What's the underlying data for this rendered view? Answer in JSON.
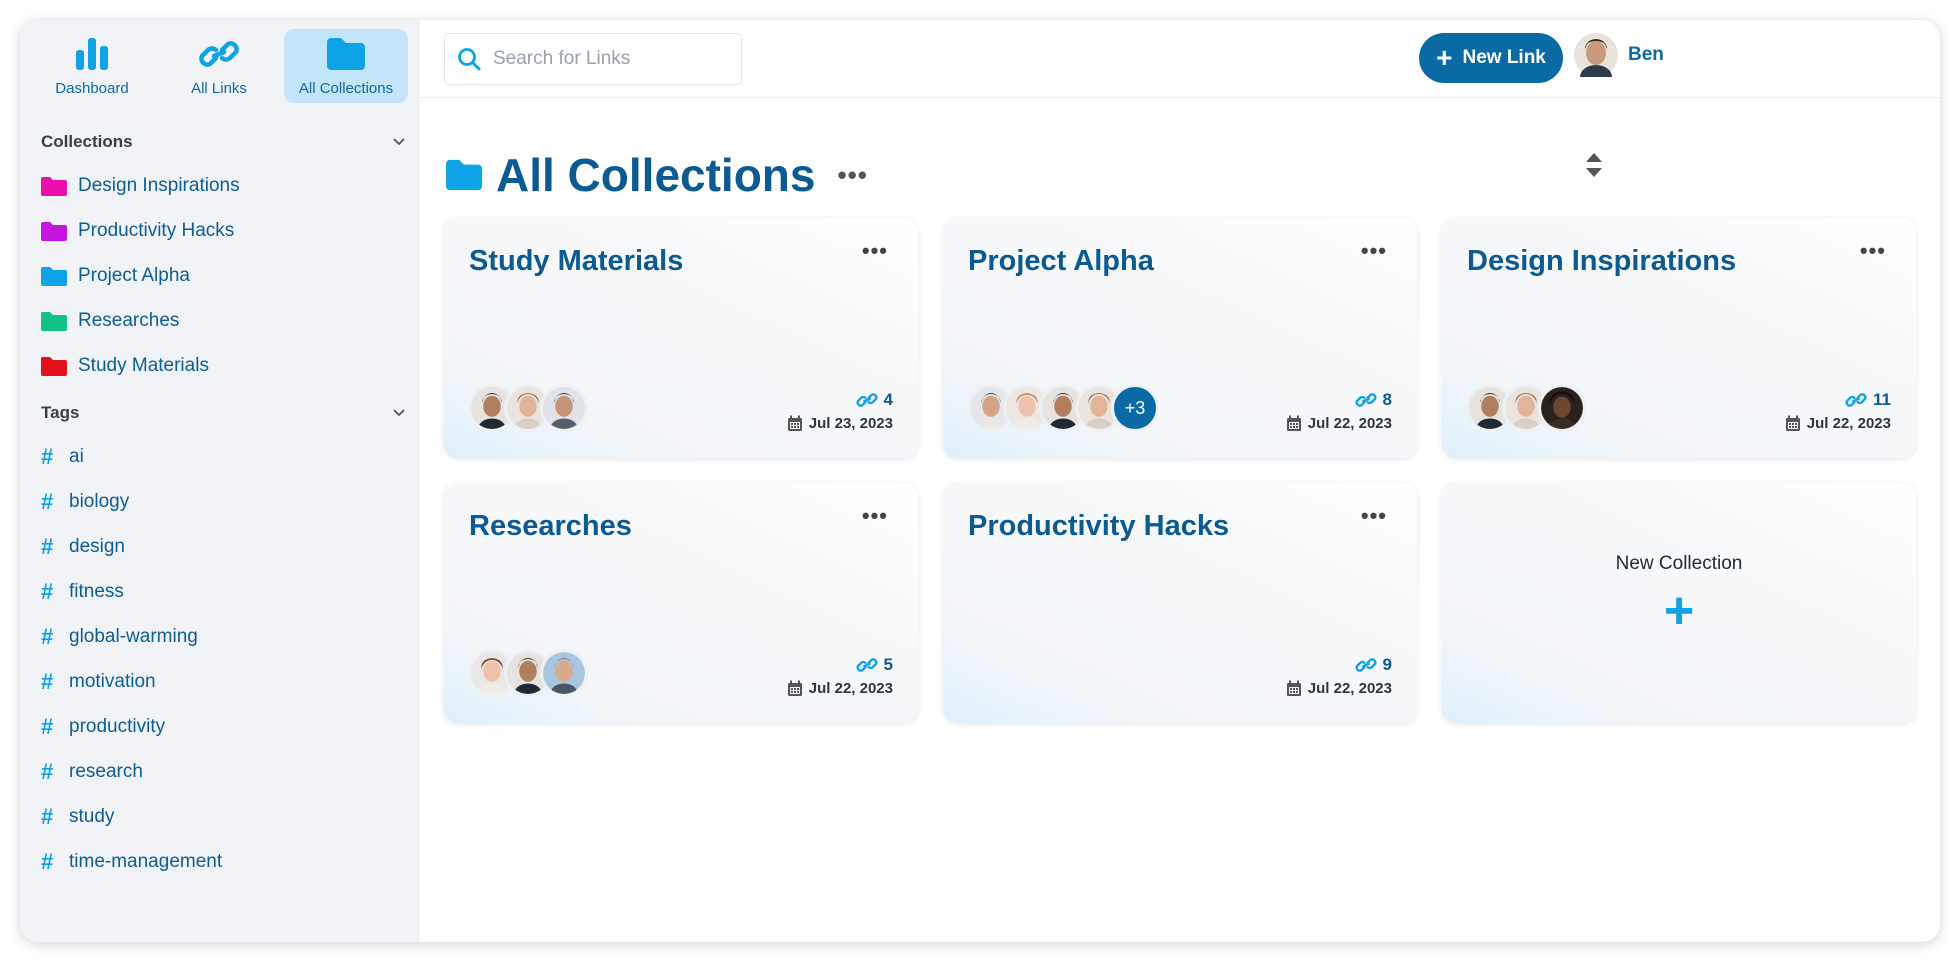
{
  "nav": {
    "dashboard": "Dashboard",
    "all_links": "All Links",
    "all_collections": "All Collections"
  },
  "sidebar": {
    "collections_heading": "Collections",
    "collections": [
      {
        "label": "Design Inspirations",
        "color": "#ec0fae"
      },
      {
        "label": "Productivity Hacks",
        "color": "#c414e0"
      },
      {
        "label": "Project Alpha",
        "color": "#0ea2e6"
      },
      {
        "label": "Researches",
        "color": "#10c285"
      },
      {
        "label": "Study Materials",
        "color": "#e3111b"
      }
    ],
    "tags_heading": "Tags",
    "tags": [
      "ai",
      "biology",
      "design",
      "fitness",
      "global-warming",
      "motivation",
      "productivity",
      "research",
      "study",
      "time-management"
    ]
  },
  "topbar": {
    "search_placeholder": "Search for Links",
    "new_link_label": "New Link",
    "user_name": "Ben"
  },
  "page": {
    "title": "All Collections"
  },
  "cards": [
    {
      "name": "Study Materials",
      "links": "4",
      "date": "Jul 23, 2023",
      "members": 3,
      "extra": ""
    },
    {
      "name": "Project Alpha",
      "links": "8",
      "date": "Jul 22, 2023",
      "members": 4,
      "extra": "+3"
    },
    {
      "name": "Design Inspirations",
      "links": "11",
      "date": "Jul 22, 2023",
      "members": 3,
      "extra": ""
    },
    {
      "name": "Researches",
      "links": "5",
      "date": "Jul 22, 2023",
      "members": 3,
      "extra": ""
    },
    {
      "name": "Productivity Hacks",
      "links": "9",
      "date": "Jul 22, 2023",
      "members": 0,
      "extra": ""
    }
  ],
  "new_collection": {
    "label": "New Collection"
  },
  "colors": {
    "accent": "#0ea2e6",
    "primary": "#0a6aa6",
    "text_primary": "#0b5a91"
  }
}
